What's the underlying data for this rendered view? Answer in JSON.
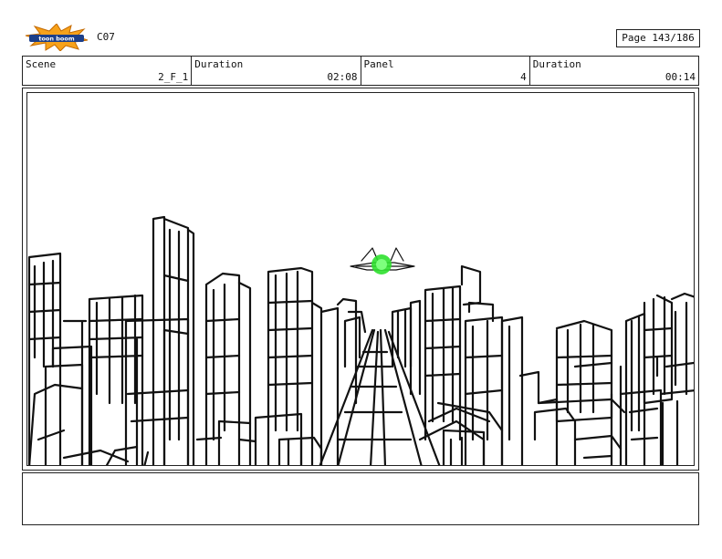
{
  "header": {
    "logo_text": "toon boom",
    "code": "C07",
    "page": "Page 143/186"
  },
  "info": {
    "scene_label": "Scene",
    "scene_value": "2_F_1",
    "duration1_label": "Duration",
    "duration1_value": "02:08",
    "panel_label": "Panel",
    "panel_value": "4",
    "duration2_label": "Duration",
    "duration2_value": "00:14"
  },
  "colors": {
    "logo_burst": "#f7a21b",
    "logo_band": "#1c3f8a",
    "ship_glow": "#2ee02e"
  },
  "icons": {
    "logo": "toon-boom-logo",
    "ship": "spaceship-icon"
  }
}
